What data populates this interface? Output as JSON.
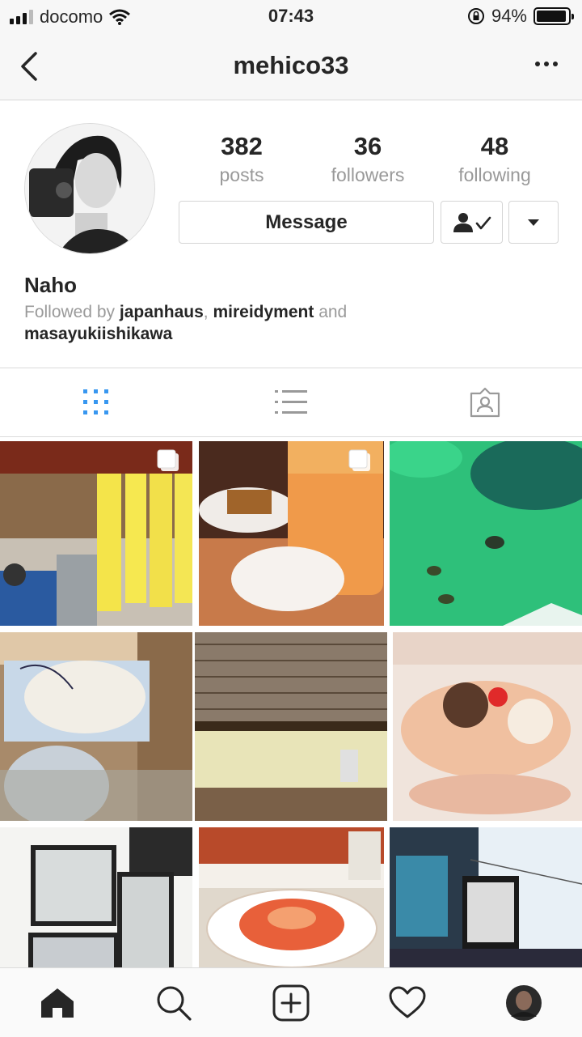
{
  "status_bar": {
    "carrier": "docomo",
    "time": "07:43",
    "battery": "94%",
    "battery_level": 0.94
  },
  "nav": {
    "title": "mehico33"
  },
  "profile": {
    "name": "Naho",
    "stats": [
      {
        "value": "382",
        "label": "posts"
      },
      {
        "value": "36",
        "label": "followers"
      },
      {
        "value": "48",
        "label": "following"
      }
    ],
    "message_button": "Message",
    "followed_by": {
      "prefix": "Followed by",
      "user1": "japanhaus",
      "sep": ",",
      "user2": "mireidyment",
      "and": "and",
      "user3": "masayukiishikawa"
    }
  },
  "tabs": [
    {
      "name": "grid",
      "active": true
    },
    {
      "name": "list",
      "active": false
    },
    {
      "name": "tagged",
      "active": false
    }
  ],
  "colors": {
    "active_tab": "#3897f0",
    "inactive_icon": "#999999",
    "text": "#262626",
    "secondary_text": "#999999",
    "border": "#dbdbdb"
  },
  "grid_posts": [
    {
      "subject": "izakaya menu with yellow paper strips",
      "multi": true
    },
    {
      "subject": "iced tea and cake",
      "multi": true
    },
    {
      "subject": "turtles in green pond",
      "multi": false
    },
    {
      "subject": "cat mural in station",
      "multi": false
    },
    {
      "subject": "bamboo blinds and statue",
      "multi": false
    },
    {
      "subject": "ice cream parfait",
      "multi": false
    },
    {
      "subject": "framed photos on wall",
      "multi": false
    },
    {
      "subject": "spaghetti with tomato sauce",
      "multi": false
    },
    {
      "subject": "festival screen stage",
      "multi": false
    }
  ],
  "bottom_bar": [
    "home-icon",
    "search-icon",
    "add-post-icon",
    "heart-icon",
    "profile-avatar"
  ]
}
